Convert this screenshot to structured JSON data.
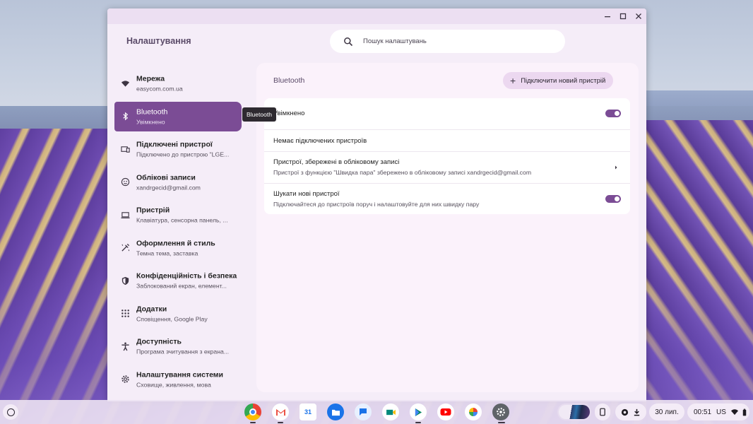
{
  "window": {
    "title": "Налаштування",
    "controls": {
      "minimize": "minimize-icon",
      "maximize": "maximize-icon",
      "close": "close-icon"
    }
  },
  "search": {
    "placeholder": "Пошук налаштувань",
    "icon": "search-icon"
  },
  "sidebar": {
    "items": [
      {
        "label": "Мережа",
        "sublabel": "easycom.com.ua",
        "icon": "wifi-icon",
        "active": false
      },
      {
        "label": "Bluetooth",
        "sublabel": "Увімкнено",
        "icon": "bluetooth-icon",
        "active": true
      },
      {
        "label": "Підключені пристрої",
        "sublabel": "Підключено до пристрою \"LGE...",
        "icon": "connected-devices-icon",
        "active": false
      },
      {
        "label": "Облікові записи",
        "sublabel": "xandrgecid@gmail.com",
        "icon": "account-icon",
        "active": false
      },
      {
        "label": "Пристрій",
        "sublabel": "Клавіатура, сенсорна панель, ...",
        "icon": "laptop-icon",
        "active": false
      },
      {
        "label": "Оформлення й стиль",
        "sublabel": "Темна тема, заставка",
        "icon": "palette-icon",
        "active": false
      },
      {
        "label": "Конфіденційність і безпека",
        "sublabel": "Заблокований екран, елемент...",
        "icon": "shield-icon",
        "active": false
      },
      {
        "label": "Додатки",
        "sublabel": "Сповіщення, Google Play",
        "icon": "apps-grid-icon",
        "active": false
      },
      {
        "label": "Доступність",
        "sublabel": "Програма зчитування з екрана...",
        "icon": "accessibility-icon",
        "active": false
      },
      {
        "label": "Налаштування системи",
        "sublabel": "Сховище, живлення, мова",
        "icon": "gear-icon",
        "active": false
      }
    ]
  },
  "tooltip": {
    "text": "Bluetooth"
  },
  "main": {
    "title": "Bluetooth",
    "add_button": "Підключити новий пристрій",
    "rows": {
      "enabled": {
        "label": "Увімкнено",
        "toggle": true
      },
      "no_devices": {
        "label": "Немає підключених пристроїв"
      },
      "saved": {
        "label": "Пристрої, збережені в обліковому записі",
        "sublabel": "Пристрої з функцією \"Швидка пара\" збережено в обліковому записі xandrgecid@gmail.com"
      },
      "find_new": {
        "label": "Шукати нові пристрої",
        "sublabel": "Підключайтеся до пристроїв поруч і налаштовуйте для них швидку пару",
        "toggle": true
      }
    }
  },
  "shelf": {
    "apps": [
      {
        "name": "chrome",
        "icon": "chrome-icon",
        "color": "#d93025"
      },
      {
        "name": "gmail",
        "icon": "gmail-icon",
        "color": "#ea4335"
      },
      {
        "name": "calendar",
        "icon": "calendar-icon",
        "color": "#1a73e8"
      },
      {
        "name": "files",
        "icon": "files-icon",
        "color": "#1a73e8"
      },
      {
        "name": "messages",
        "icon": "messages-icon",
        "color": "#1a73e8"
      },
      {
        "name": "meet",
        "icon": "meet-icon",
        "color": "#00897b"
      },
      {
        "name": "play-store",
        "icon": "play-store-icon",
        "color": "#01875f"
      },
      {
        "name": "youtube",
        "icon": "youtube-icon",
        "color": "#ff0000"
      },
      {
        "name": "photos",
        "icon": "photos-icon",
        "color": "#fbbc04"
      },
      {
        "name": "settings",
        "icon": "settings-app-icon",
        "color": "#5f6368"
      }
    ],
    "date": "30 лип.",
    "time": "00:51",
    "keyboard_layout": "US"
  }
}
